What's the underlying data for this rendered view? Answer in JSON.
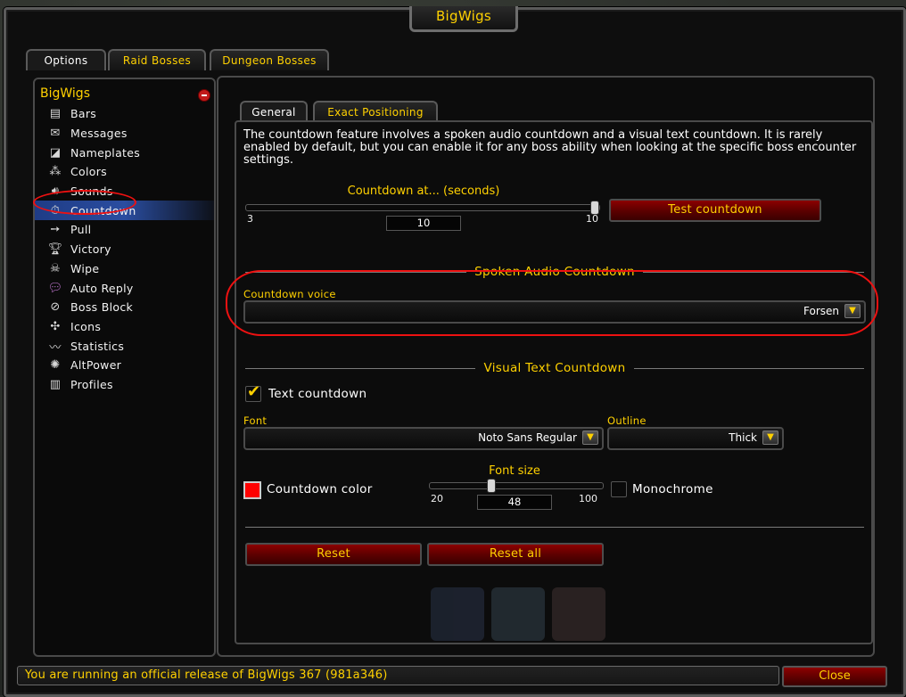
{
  "window": {
    "title": "BigWigs"
  },
  "top_tabs": [
    {
      "label": "Options",
      "active": true
    },
    {
      "label": "Raid Bosses",
      "active": false
    },
    {
      "label": "Dungeon Bosses",
      "active": false
    }
  ],
  "sidebar": {
    "root_label": "BigWigs",
    "items": [
      {
        "label": "Bars",
        "icon": "bars-icon"
      },
      {
        "label": "Messages",
        "icon": "envelope-icon"
      },
      {
        "label": "Nameplates",
        "icon": "nameplate-icon"
      },
      {
        "label": "Colors",
        "icon": "color-dots-icon"
      },
      {
        "label": "Sounds",
        "icon": "speaker-icon"
      },
      {
        "label": "Countdown",
        "icon": "stopwatch-icon",
        "selected": true
      },
      {
        "label": "Pull",
        "icon": "arrow-right-icon"
      },
      {
        "label": "Victory",
        "icon": "trophy-icon"
      },
      {
        "label": "Wipe",
        "icon": "skull-icon"
      },
      {
        "label": "Auto Reply",
        "icon": "chat-bubble-icon"
      },
      {
        "label": "Boss Block",
        "icon": "block-icon"
      },
      {
        "label": "Icons",
        "icon": "raid-icons-icon"
      },
      {
        "label": "Statistics",
        "icon": "graph-icon"
      },
      {
        "label": "AltPower",
        "icon": "sun-icon"
      },
      {
        "label": "Profiles",
        "icon": "profile-icon"
      }
    ]
  },
  "sub_tabs": [
    {
      "label": "General",
      "active": true
    },
    {
      "label": "Exact Positioning",
      "active": false
    }
  ],
  "description": "The countdown feature involves a spoken audio countdown and a visual text countdown. It is rarely enabled by default, but you can enable it for any boss ability when looking at the specific boss encounter settings.",
  "countdown_slider": {
    "label": "Countdown at... (seconds)",
    "min": "3",
    "max": "10",
    "value": "10",
    "level": 1.0
  },
  "test_button": "Test countdown",
  "spoken_section": {
    "heading": "Spoken Audio Countdown",
    "voice_label": "Countdown voice",
    "voice_value": "Forsen"
  },
  "visual_section": {
    "heading": "Visual Text Countdown",
    "text_countdown_label": "Text countdown",
    "text_countdown_checked": true,
    "font_label": "Font",
    "font_value": "Noto Sans Regular",
    "outline_label": "Outline",
    "outline_value": "Thick",
    "color_label": "Countdown color",
    "color_value": "#ff0000",
    "font_size_label": "Font size",
    "font_size_min": "20",
    "font_size_max": "100",
    "font_size_value": "48",
    "font_size_level": 0.35,
    "monochrome_label": "Monochrome",
    "monochrome_checked": false
  },
  "buttons": {
    "reset": "Reset",
    "reset_all": "Reset all",
    "close": "Close"
  },
  "status_text": "You are running an official release of BigWigs 367 (981a346)",
  "colors": {
    "gold": "#ffd100",
    "button_red": "#8c0000",
    "selection_blue": "#2a4da0",
    "annotation_red": "#ee1111"
  }
}
